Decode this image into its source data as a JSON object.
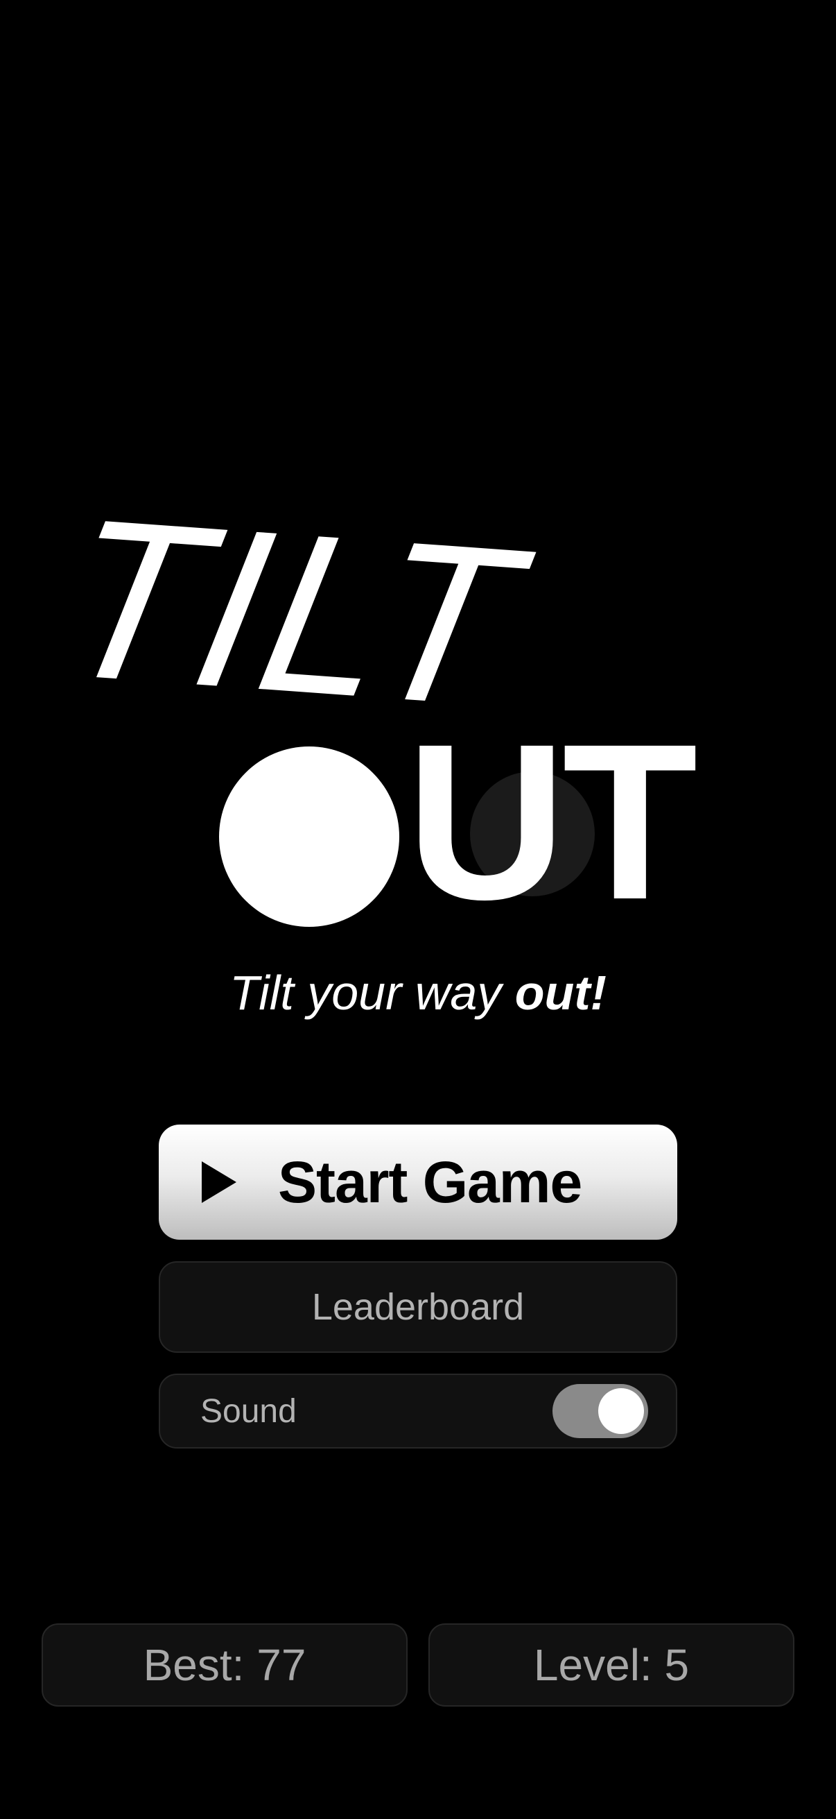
{
  "logo": {
    "word_top": "TILT",
    "word_bottom_letters": "UT",
    "ball_icon": "ball-icon",
    "hole_icon": "hole-icon"
  },
  "tagline": {
    "regular": "Tilt your way ",
    "bold": "out!"
  },
  "menu": {
    "start_icon": "play-icon",
    "start_label": "Start Game",
    "leaderboard_label": "Leaderboard",
    "sound_label": "Sound",
    "sound_enabled": true
  },
  "stats": {
    "best": "Best: 77",
    "level": "Level: 5"
  },
  "colors": {
    "background": "#000000",
    "accent": "#ffffff",
    "panel": "#111111",
    "muted_text": "#b3b3b3",
    "toggle_track": "#8a8a8a"
  }
}
